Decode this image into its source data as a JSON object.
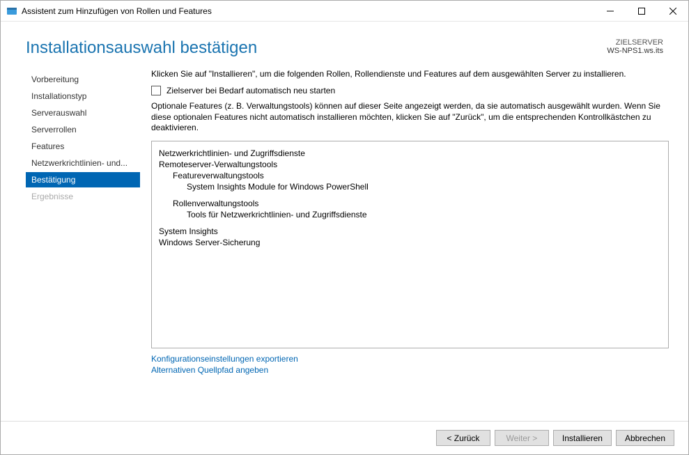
{
  "window": {
    "title": "Assistent zum Hinzufügen von Rollen und Features"
  },
  "header": {
    "page_title": "Installationsauswahl bestätigen",
    "server_label": "ZIELSERVER",
    "server_name": "WS-NPS1.ws.its"
  },
  "sidebar": {
    "items": [
      {
        "label": "Vorbereitung"
      },
      {
        "label": "Installationstyp"
      },
      {
        "label": "Serverauswahl"
      },
      {
        "label": "Serverrollen"
      },
      {
        "label": "Features"
      },
      {
        "label": "Netzwerkrichtlinien- und..."
      },
      {
        "label": "Bestätigung"
      },
      {
        "label": "Ergebnisse"
      }
    ]
  },
  "content": {
    "intro": "Klicken Sie auf \"Installieren\", um die folgenden Rollen, Rollendienste und Features auf dem ausgewählten Server zu installieren.",
    "restart_checkbox_label": "Zielserver bei Bedarf automatisch neu starten",
    "optional_text": "Optionale Features (z. B. Verwaltungstools) können auf dieser Seite angezeigt werden, da sie automatisch ausgewählt wurden. Wenn Sie diese optionalen Features nicht automatisch installieren möchten, klicken Sie auf \"Zurück\", um die entsprechenden Kontrollkästchen zu deaktivieren.",
    "features": {
      "f1": "Netzwerkrichtlinien- und Zugriffsdienste",
      "f2": "Remoteserver-Verwaltungstools",
      "f2a": "Featureverwaltungstools",
      "f2a1": "System Insights Module for Windows PowerShell",
      "f2b": "Rollenverwaltungstools",
      "f2b1": "Tools für Netzwerkrichtlinien- und Zugriffsdienste",
      "f3": "System Insights",
      "f4": "Windows Server-Sicherung"
    },
    "link_export": "Konfigurationseinstellungen exportieren",
    "link_altpath": "Alternativen Quellpfad angeben"
  },
  "footer": {
    "back": "< Zurück",
    "next": "Weiter >",
    "install": "Installieren",
    "cancel": "Abbrechen"
  }
}
